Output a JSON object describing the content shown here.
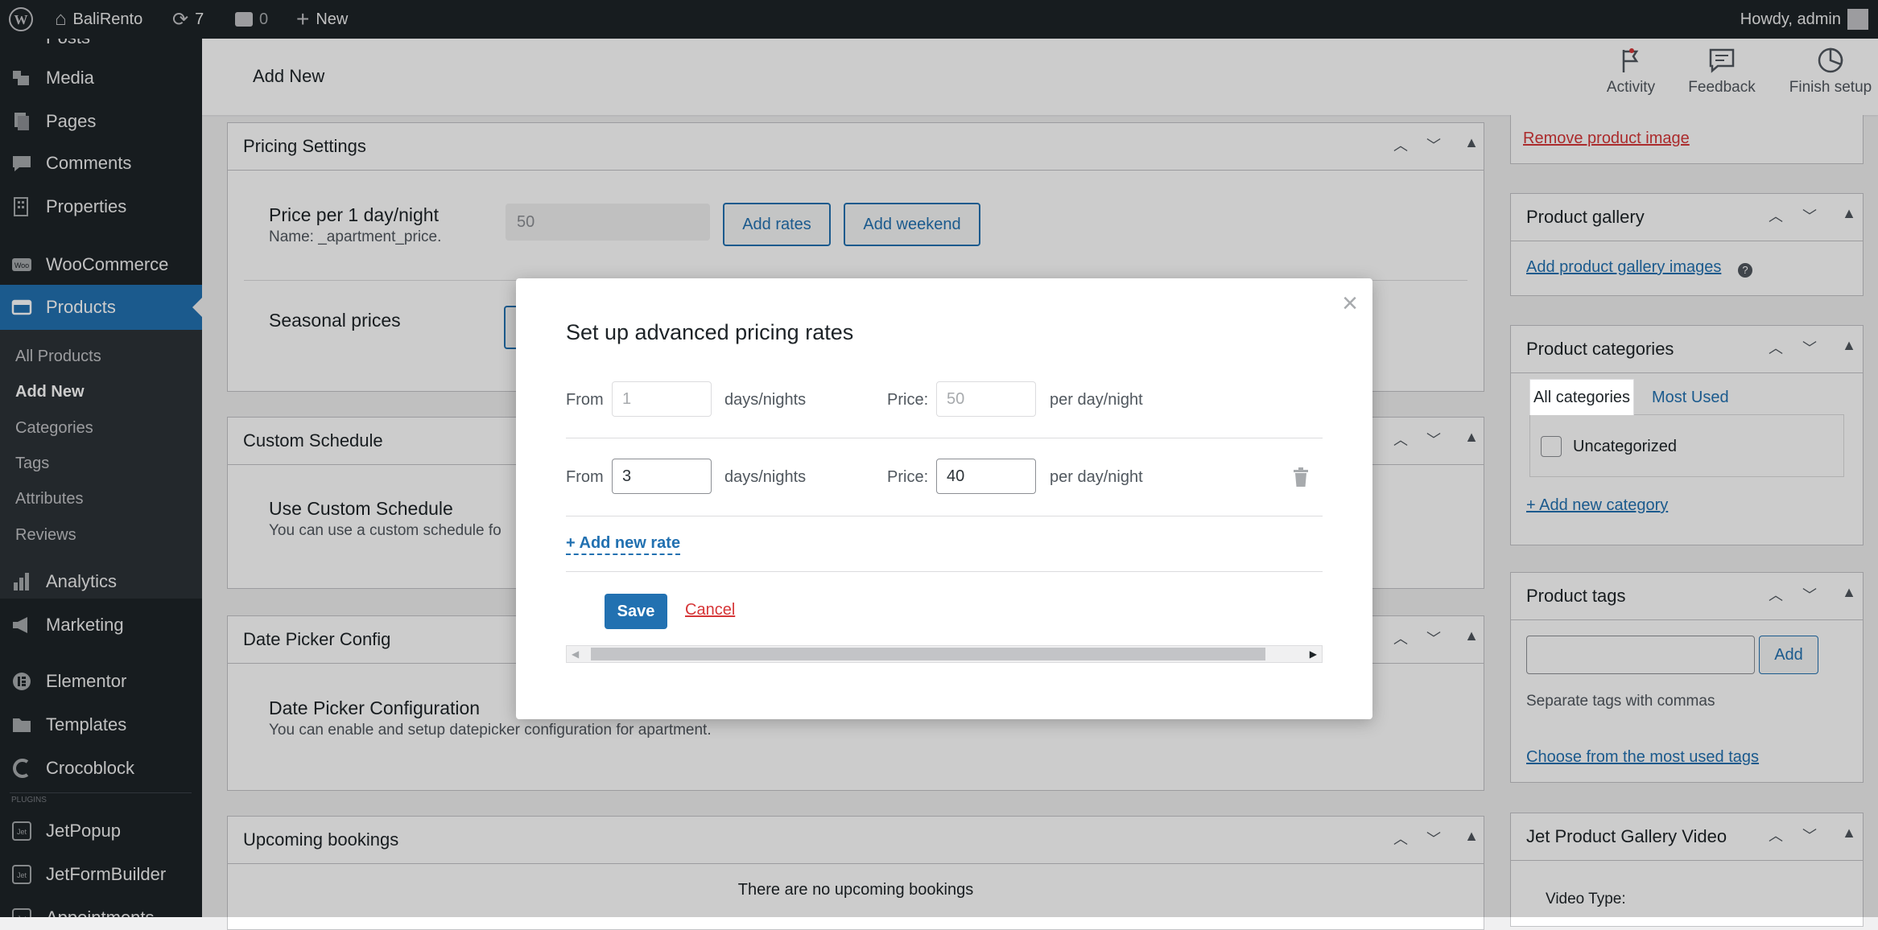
{
  "adminbar": {
    "site_name": "BaliRento",
    "updates_count": "7",
    "comments_count": "0",
    "new_label": "New",
    "howdy": "Howdy, admin"
  },
  "sidebar": {
    "partial_top": "Posts",
    "items": [
      {
        "label": "Media",
        "icon": "media-icon"
      },
      {
        "label": "Pages",
        "icon": "pages-icon"
      },
      {
        "label": "Comments",
        "icon": "comments-icon"
      },
      {
        "label": "Properties",
        "icon": "building-icon"
      },
      {
        "label": "WooCommerce",
        "icon": "woocommerce-icon"
      },
      {
        "label": "Products",
        "icon": "products-icon"
      },
      {
        "label": "Analytics",
        "icon": "analytics-icon"
      },
      {
        "label": "Marketing",
        "icon": "megaphone-icon"
      },
      {
        "label": "Elementor",
        "icon": "elementor-icon"
      },
      {
        "label": "Templates",
        "icon": "folder-icon"
      },
      {
        "label": "Crocoblock",
        "icon": "crocoblock-icon"
      },
      {
        "label": "JetPopup",
        "icon": "jet-icon"
      },
      {
        "label": "JetFormBuilder",
        "icon": "jet-icon"
      },
      {
        "label": "Appointments",
        "icon": "jet-icon"
      }
    ],
    "submenu": [
      "All Products",
      "Add New",
      "Categories",
      "Tags",
      "Attributes",
      "Reviews"
    ],
    "plugins_divider": "PLUGINS"
  },
  "header": {
    "title": "Add New",
    "activity": "Activity",
    "feedback": "Feedback",
    "finish_setup": "Finish setup"
  },
  "pricing": {
    "title": "Pricing Settings",
    "price_label": "Price per 1 day/night",
    "price_name": "Name: _apartment_price.",
    "price_value": "50",
    "add_rates": "Add rates",
    "add_weekend": "Add weekend",
    "seasonal": "Seasonal prices"
  },
  "custom_schedule": {
    "title": "Custom Schedule",
    "field": "Use Custom Schedule",
    "desc": "You can use a custom schedule fo"
  },
  "date_picker": {
    "title": "Date Picker Config",
    "field": "Date Picker Configuration",
    "desc": "You can enable and setup datepicker configuration for apartment."
  },
  "upcoming": {
    "title": "Upcoming bookings",
    "empty": "There are no upcoming bookings"
  },
  "right": {
    "remove_image": "Remove product image",
    "gallery_title": "Product gallery",
    "gallery_link": "Add product gallery images",
    "cat_title": "Product categories",
    "cat_tab_all": "All categories",
    "cat_tab_used": "Most Used",
    "cat_uncategorized": "Uncategorized",
    "cat_add": "+ Add new category",
    "tags_title": "Product tags",
    "tags_add": "Add",
    "tags_hint": "Separate tags with commas",
    "tags_choose": "Choose from the most used tags",
    "video_title": "Jet Product Gallery Video",
    "video_type": "Video Type:"
  },
  "modal": {
    "title": "Set up advanced pricing rates",
    "from": "From",
    "days": "days/nights",
    "price": "Price:",
    "per": "per day/night",
    "rows": [
      {
        "from": "1",
        "price": "50"
      },
      {
        "from": "3",
        "price": "40"
      }
    ],
    "add_rate": "+ Add new rate",
    "save": "Save",
    "cancel": "Cancel"
  },
  "colors": {
    "accent": "#2271b1",
    "sidebar_bg": "#1d2327",
    "active_item": "#2271b1",
    "cancel_link": "#d63638"
  }
}
